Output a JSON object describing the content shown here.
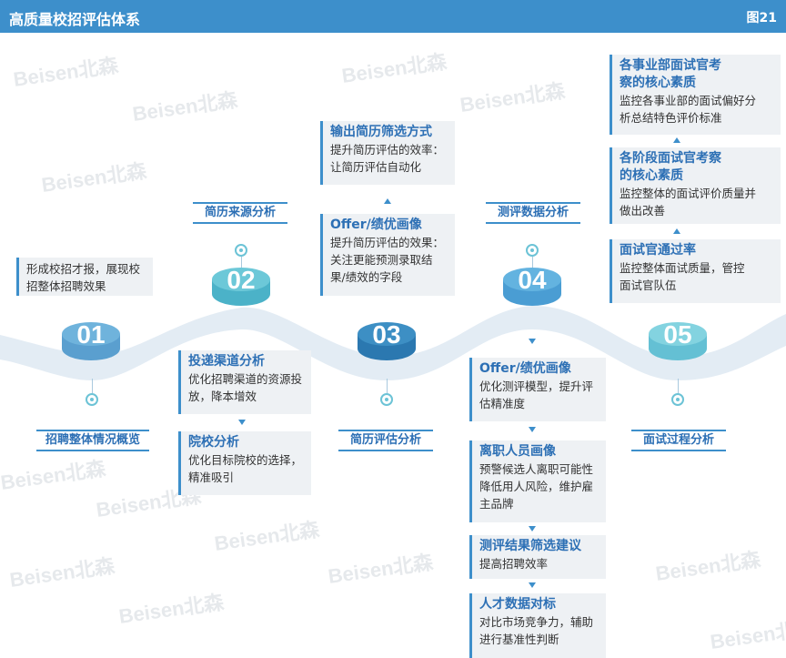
{
  "header": {
    "title": "高质量校招评估体系",
    "figure_no": "图21"
  },
  "watermark": "Beisen北森",
  "stages": [
    {
      "num": "01",
      "label": "招聘整体情况概览",
      "color": "#5a9fcf",
      "top": "#6fb3dc"
    },
    {
      "num": "02",
      "label": "简历来源分析",
      "color": "#4bb2c8",
      "top": "#6cc8d8"
    },
    {
      "num": "03",
      "label": "简历评估分析",
      "color": "#2b78b0",
      "top": "#3d8fc4"
    },
    {
      "num": "04",
      "label": "测评数据分析",
      "color": "#4a9dd3",
      "top": "#63b3e0"
    },
    {
      "num": "05",
      "label": "面试过程分析",
      "color": "#64c0d4",
      "top": "#83d3e0"
    }
  ],
  "boxes": {
    "b01": {
      "body": "形成校招才报，展现校招整体招聘效果"
    },
    "b02a": {
      "title": "投递渠道分析",
      "body": "优化招聘渠道的资源投放，降本增效"
    },
    "b02b": {
      "title": "院校分析",
      "body": "优化目标院校的选择，精准吸引"
    },
    "b03a": {
      "title": "输出简历筛选方式",
      "body": "提升简历评估的效率：让简历评估自动化"
    },
    "b03b": {
      "title": "Offer/绩优画像",
      "body": "提升简历评估的效果：关注更能预测录取结果/绩效的字段"
    },
    "b04a": {
      "title": "Offer/绩优画像",
      "body": "优化测评模型，提升评估精准度"
    },
    "b04b": {
      "title": "离职人员画像",
      "body": "预警候选人离职可能性降低用人风险，维护雇主品牌"
    },
    "b04c": {
      "title": "测评结果筛选建议",
      "body": "提高招聘效率"
    },
    "b04d": {
      "title": "人才数据对标",
      "body": "对比市场竞争力，辅助进行基准性判断"
    },
    "b05a": {
      "title": "各事业部面试官考察的核心素质",
      "body": "监控各事业部的面试偏好分析总结特色评价标准"
    },
    "b05b": {
      "title": "各阶段面试官考察的核心素质",
      "body": "监控整体的面试评价质量并做出改善"
    },
    "b05c": {
      "title": "面试官通过率",
      "body": "监控整体面试质量，管控面试官队伍"
    }
  }
}
